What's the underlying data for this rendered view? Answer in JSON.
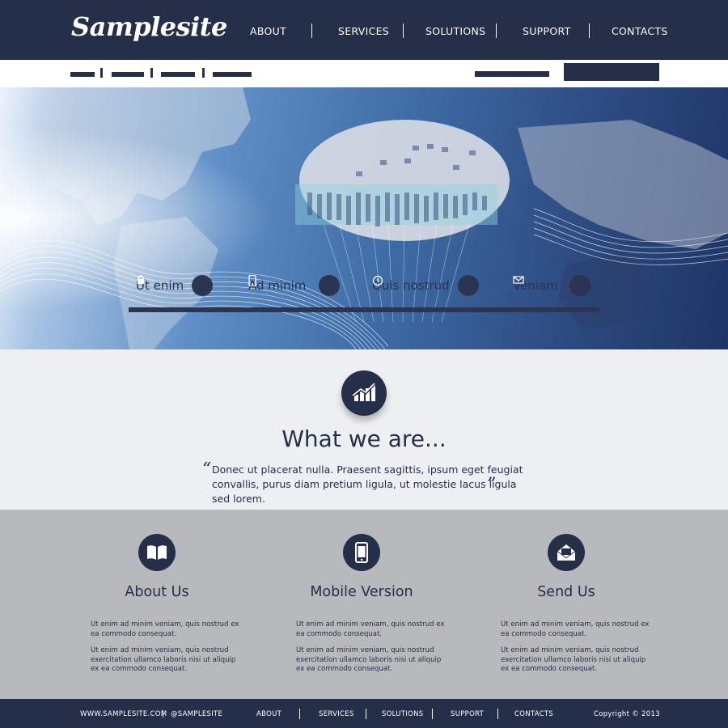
{
  "header": {
    "logo": "Samplesite",
    "nav": [
      "ABOUT",
      "SERVICES",
      "SOLUTIONS",
      "SUPPORT",
      "CONTACTS"
    ]
  },
  "hero": {
    "items": [
      {
        "label": "Ut enim",
        "icon": "lock-icon"
      },
      {
        "label": "Ad minim",
        "icon": "mobile-icon"
      },
      {
        "label": "Quis nostrud",
        "icon": "clock-icon"
      },
      {
        "label": "Veniam",
        "icon": "mail-icon"
      }
    ]
  },
  "intro": {
    "title": "What we are...",
    "quote_open": "“",
    "quote_close": "”",
    "text": "Donec ut placerat nulla. Praesent sagittis, ipsum eget feugiat convallis, purus diam pretium ligula, ut molestie lacus ligula sed lorem."
  },
  "features": [
    {
      "title": "About Us",
      "icon": "book-icon",
      "p1": "Ut enim ad minim veniam, quis nostrud ex ea commodo consequat.",
      "p2": "Ut enim ad minim veniam, quis nostrud exercitation ullamco laboris nisi ut aliquip ex ea commodo consequat."
    },
    {
      "title": "Mobile Version",
      "icon": "mobile-icon",
      "p1": "Ut enim ad minim veniam, quis nostrud ex ea commodo consequat.",
      "p2": "Ut enim ad minim veniam, quis nostrud exercitation ullamco laboris nisi ut aliquip ex ea commodo consequat."
    },
    {
      "title": "Send Us",
      "icon": "envelope-icon",
      "p1": "Ut enim ad minim veniam, quis nostrud ex ea commodo consequat.",
      "p2": "Ut enim ad minim veniam, quis nostrud exercitation ullamco laboris nisi ut aliquip ex ea commodo consequat."
    }
  ],
  "footer": {
    "website": "WWW.SAMPLESITE.COM",
    "divider": "|",
    "handle": "@SAMPLESITE",
    "nav": [
      "ABOUT",
      "SERVICES",
      "SOLUTIONS",
      "SUPPORT",
      "CONTACTS"
    ],
    "copyright": "Copyright © 2013"
  },
  "colors": {
    "navy": "#262f4a",
    "light_section": "#eeeff2",
    "gray_section": "#b8b9bc"
  }
}
